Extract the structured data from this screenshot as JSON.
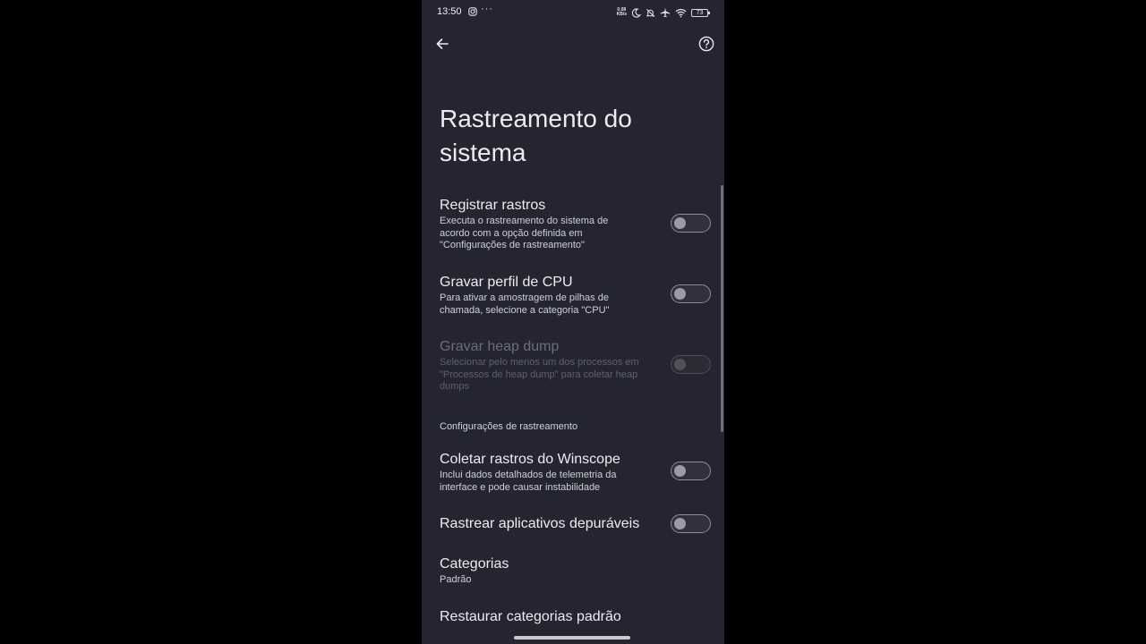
{
  "status_bar": {
    "time": "13:50",
    "more": "···",
    "net_speed_value": "0.08",
    "net_speed_unit": "KB/s",
    "battery": "73"
  },
  "icons": {
    "back": "arrow-left",
    "help": "question-circle",
    "instagram": "instagram-notification",
    "moon": "do-not-disturb",
    "bell_off": "silent-mode",
    "airplane": "airplane-mode",
    "wifi": "wifi-signal"
  },
  "page": {
    "title": "Rastreamento do sistema"
  },
  "prefs": [
    {
      "title": "Registrar rastros",
      "summary": "Executa o rastreamento do sistema de acordo com a opção definida em \"Configurações de rastreamento\"",
      "enabled": true,
      "checked": false
    },
    {
      "title": "Gravar perfil de CPU",
      "summary": "Para ativar a amostragem de pilhas de chamada, selecione a categoria \"CPU\"",
      "enabled": true,
      "checked": false
    },
    {
      "title": "Gravar heap dump",
      "summary": "Selecionar pelo menos um dos processos em \"Processos de heap dump\" para coletar heap dumps",
      "enabled": false,
      "checked": false
    }
  ],
  "section": {
    "header": "Configurações de rastreamento"
  },
  "settings_prefs": [
    {
      "title": "Coletar rastros do Winscope",
      "summary": "Inclui dados detalhados de telemetria da interface e pode causar instabilidade",
      "checked": false
    },
    {
      "title": "Rastrear aplicativos depuráveis",
      "checked": false
    },
    {
      "title": "Categorias",
      "summary": "Padrão"
    },
    {
      "title": "Restaurar categorias padrão"
    }
  ],
  "colors": {
    "background": "#242530",
    "outer": "#000000",
    "text_primary": "#ececf0",
    "text_secondary": "#cfd0d6",
    "text_disabled": "#6c6d76",
    "toggle_track": "#8b8c95"
  }
}
